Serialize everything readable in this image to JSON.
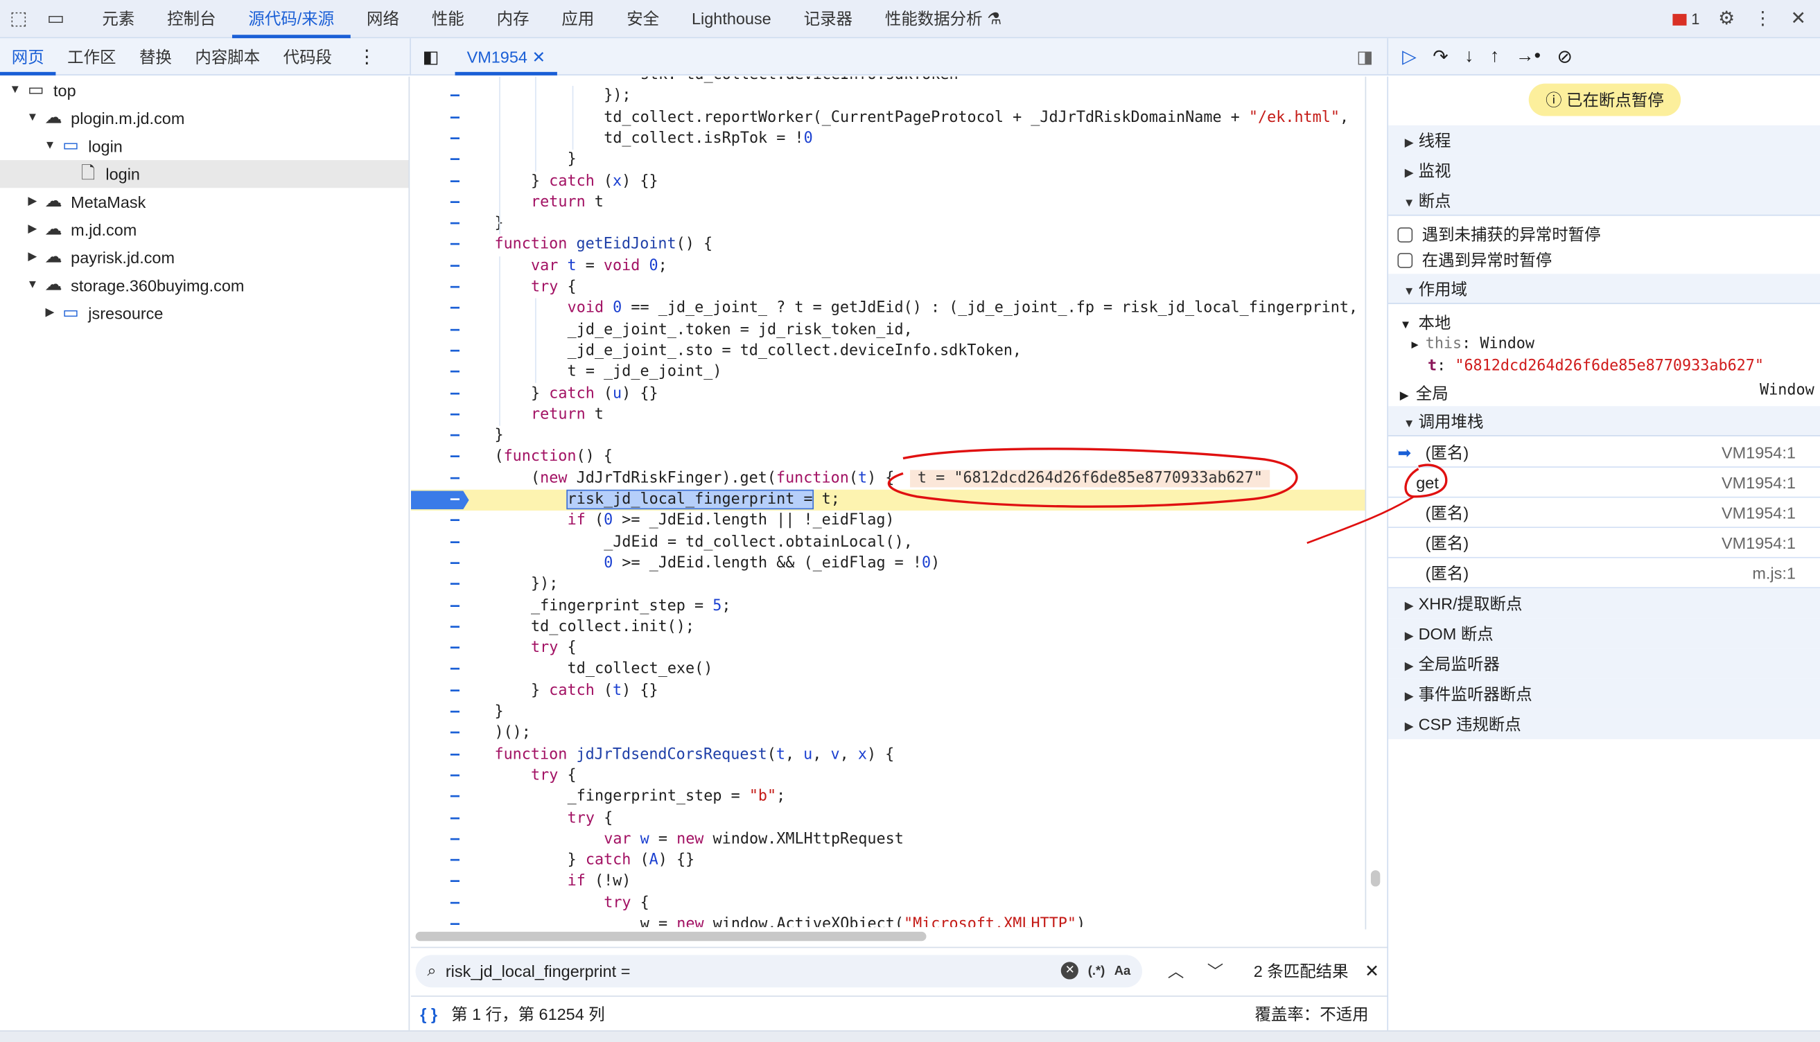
{
  "toolbar": {
    "tabs": [
      "元素",
      "控制台",
      "源代码/来源",
      "网络",
      "性能",
      "内存",
      "应用",
      "安全",
      "Lighthouse",
      "记录器",
      "性能数据分析 ⚗"
    ],
    "active": 2,
    "error_count": "1"
  },
  "navigator": {
    "tabs": [
      "网页",
      "工作区",
      "替换",
      "内容脚本",
      "代码段"
    ],
    "active": 0,
    "tree": [
      {
        "label": "top",
        "depth": 0,
        "open": true,
        "icon": "window-icon"
      },
      {
        "label": "plogin.m.jd.com",
        "depth": 1,
        "open": true,
        "icon": "cloud-icon"
      },
      {
        "label": "login",
        "depth": 2,
        "open": true,
        "icon": "folder-icon"
      },
      {
        "label": "login",
        "depth": 3,
        "open": null,
        "icon": "file-icon",
        "selected": true
      },
      {
        "label": "MetaMask",
        "depth": 1,
        "open": false,
        "icon": "cloud-icon"
      },
      {
        "label": "m.jd.com",
        "depth": 1,
        "open": false,
        "icon": "cloud-icon"
      },
      {
        "label": "payrisk.jd.com",
        "depth": 1,
        "open": false,
        "icon": "cloud-icon"
      },
      {
        "label": "storage.360buyimg.com",
        "depth": 1,
        "open": true,
        "icon": "cloud-icon"
      },
      {
        "label": "jsresource",
        "depth": 2,
        "open": false,
        "icon": "folder-icon"
      }
    ]
  },
  "editor": {
    "file_tab": "VM1954",
    "current_line": 20,
    "lines": [
      {
        "i": 4,
        "t": [
          [
            "p",
            "stk: td_collect.deviceInfo.sdkToken"
          ]
        ]
      },
      {
        "i": 3,
        "t": [
          [
            "p",
            "});"
          ]
        ]
      },
      {
        "i": 3,
        "t": [
          [
            "p",
            "td_collect.reportWorker(_CurrentPageProtocol + _JdJrTdRiskDomainName + "
          ],
          [
            "s",
            "\"/ek.html\""
          ],
          [
            "p",
            ","
          ]
        ]
      },
      {
        "i": 3,
        "t": [
          [
            "p",
            "td_collect.isRpTok = !"
          ],
          [
            "n",
            "0"
          ]
        ]
      },
      {
        "i": 2,
        "t": [
          [
            "p",
            "}"
          ]
        ]
      },
      {
        "i": 1,
        "t": [
          [
            "p",
            "} "
          ],
          [
            "k",
            "catch"
          ],
          [
            "p",
            " ("
          ],
          [
            "n",
            "x"
          ],
          [
            "p",
            ") {}"
          ]
        ]
      },
      {
        "i": 1,
        "t": [
          [
            "k",
            "return"
          ],
          [
            "p",
            " t"
          ]
        ]
      },
      {
        "i": 0,
        "t": [
          [
            "p",
            "}"
          ]
        ]
      },
      {
        "i": 0,
        "t": [
          [
            "k",
            "function"
          ],
          [
            "f",
            " getEidJoint"
          ],
          [
            "p",
            "() {"
          ]
        ]
      },
      {
        "i": 1,
        "t": [
          [
            "k",
            "var"
          ],
          [
            "n",
            " t"
          ],
          [
            "p",
            " = "
          ],
          [
            "k",
            "void"
          ],
          [
            "n",
            " 0"
          ],
          [
            "p",
            ";"
          ]
        ]
      },
      {
        "i": 1,
        "t": [
          [
            "k",
            "try"
          ],
          [
            "p",
            " {"
          ]
        ]
      },
      {
        "i": 2,
        "t": [
          [
            "k",
            "void"
          ],
          [
            "n",
            " 0"
          ],
          [
            "p",
            " == _jd_e_joint_ ? t = getJdEid() : (_jd_e_joint_.fp = risk_jd_local_fingerprint,"
          ]
        ]
      },
      {
        "i": 2,
        "t": [
          [
            "p",
            "_jd_e_joint_.token = jd_risk_token_id,"
          ]
        ]
      },
      {
        "i": 2,
        "t": [
          [
            "p",
            "_jd_e_joint_.sto = td_collect.deviceInfo.sdkToken,"
          ]
        ]
      },
      {
        "i": 2,
        "t": [
          [
            "p",
            "t = _jd_e_joint_)"
          ]
        ]
      },
      {
        "i": 1,
        "t": [
          [
            "p",
            "} "
          ],
          [
            "k",
            "catch"
          ],
          [
            "p",
            " ("
          ],
          [
            "n",
            "u"
          ],
          [
            "p",
            ") {}"
          ]
        ]
      },
      {
        "i": 1,
        "t": [
          [
            "k",
            "return"
          ],
          [
            "p",
            " t"
          ]
        ]
      },
      {
        "i": 0,
        "t": [
          [
            "p",
            "}"
          ]
        ]
      },
      {
        "i": 0,
        "t": [
          [
            "p",
            "("
          ],
          [
            "k",
            "function"
          ],
          [
            "p",
            "() {"
          ]
        ]
      },
      {
        "i": 1,
        "t": [
          [
            "p",
            "("
          ],
          [
            "k",
            "new"
          ],
          [
            "p",
            " JdJrTdRiskFinger).get("
          ],
          [
            "k",
            "function"
          ],
          [
            "p",
            "("
          ],
          [
            "n",
            "t"
          ],
          [
            "p",
            ") {"
          ]
        ],
        "inline": "t = \"6812dcd264d26f6de85e8770933ab627\""
      },
      {
        "i": 2,
        "t": [
          [
            "h",
            "risk_jd_local_fingerprint ="
          ],
          [
            "p",
            " t;"
          ]
        ]
      },
      {
        "i": 2,
        "t": [
          [
            "k",
            "if"
          ],
          [
            "p",
            " ("
          ],
          [
            "n",
            "0"
          ],
          [
            "p",
            " >= _JdEid.length || !_eidFlag)"
          ]
        ]
      },
      {
        "i": 3,
        "t": [
          [
            "p",
            "_JdEid = td_collect.obtainLocal(),"
          ]
        ]
      },
      {
        "i": 3,
        "t": [
          [
            "n",
            "0"
          ],
          [
            "p",
            " >= _JdEid.length && (_eidFlag = !"
          ],
          [
            "n",
            "0"
          ],
          [
            "p",
            ")"
          ]
        ]
      },
      {
        "i": 1,
        "t": [
          [
            "p",
            "});"
          ]
        ]
      },
      {
        "i": 1,
        "t": [
          [
            "p",
            "_fingerprint_step = "
          ],
          [
            "n",
            "5"
          ],
          [
            "p",
            ";"
          ]
        ]
      },
      {
        "i": 1,
        "t": [
          [
            "p",
            "td_collect.init();"
          ]
        ]
      },
      {
        "i": 1,
        "t": [
          [
            "k",
            "try"
          ],
          [
            "p",
            " {"
          ]
        ]
      },
      {
        "i": 2,
        "t": [
          [
            "p",
            "td_collect_exe()"
          ]
        ]
      },
      {
        "i": 1,
        "t": [
          [
            "p",
            "} "
          ],
          [
            "k",
            "catch"
          ],
          [
            "p",
            " ("
          ],
          [
            "n",
            "t"
          ],
          [
            "p",
            ") {}"
          ]
        ]
      },
      {
        "i": 0,
        "t": [
          [
            "p",
            "}"
          ]
        ]
      },
      {
        "i": 0,
        "t": [
          [
            "p",
            ")();"
          ]
        ]
      },
      {
        "i": 0,
        "t": [
          [
            "k",
            "function"
          ],
          [
            "f",
            " jdJrTdsendCorsRequest"
          ],
          [
            "p",
            "("
          ],
          [
            "n",
            "t"
          ],
          [
            "p",
            ", "
          ],
          [
            "n",
            "u"
          ],
          [
            "p",
            ", "
          ],
          [
            "n",
            "v"
          ],
          [
            "p",
            ", "
          ],
          [
            "n",
            "x"
          ],
          [
            "p",
            ") {"
          ]
        ]
      },
      {
        "i": 1,
        "t": [
          [
            "k",
            "try"
          ],
          [
            "p",
            " {"
          ]
        ]
      },
      {
        "i": 2,
        "t": [
          [
            "p",
            "_fingerprint_step = "
          ],
          [
            "s",
            "\"b\""
          ],
          [
            "p",
            ";"
          ]
        ]
      },
      {
        "i": 2,
        "t": [
          [
            "k",
            "try"
          ],
          [
            "p",
            " {"
          ]
        ]
      },
      {
        "i": 3,
        "t": [
          [
            "k",
            "var"
          ],
          [
            "n",
            " w"
          ],
          [
            "p",
            " = "
          ],
          [
            "k",
            "new"
          ],
          [
            "p",
            " window.XMLHttpRequest"
          ]
        ]
      },
      {
        "i": 2,
        "t": [
          [
            "p",
            "} "
          ],
          [
            "k",
            "catch"
          ],
          [
            "p",
            " ("
          ],
          [
            "n",
            "A"
          ],
          [
            "p",
            ") {}"
          ]
        ]
      },
      {
        "i": 2,
        "t": [
          [
            "k",
            "if"
          ],
          [
            "p",
            " (!w)"
          ]
        ]
      },
      {
        "i": 3,
        "t": [
          [
            "k",
            "try"
          ],
          [
            "p",
            " {"
          ]
        ]
      },
      {
        "i": 4,
        "t": [
          [
            "p",
            "w = "
          ],
          [
            "k",
            "new"
          ],
          [
            "p",
            " window.ActiveXObject("
          ],
          [
            "s",
            "\"Microsoft.XMLHTTP\""
          ],
          [
            "p",
            ")"
          ]
        ]
      }
    ]
  },
  "search": {
    "value": "risk_jd_local_fingerprint =",
    "regex_label": "(.*)",
    "case_label": "Aa",
    "result": "2 条匹配结果"
  },
  "status": {
    "position": "第 1 行，第 61254 列",
    "coverage": "覆盖率：不适用"
  },
  "debugger": {
    "paused": "已在断点暂停",
    "sections": {
      "threads": "线程",
      "watch": "监视",
      "breakpoints": "断点",
      "scope": "作用域",
      "callstack": "调用堆栈",
      "xhr": "XHR/提取断点",
      "dom": "DOM 断点",
      "global": "全局监听器",
      "event": "事件监听器断点",
      "csp": "CSP 违规断点"
    },
    "bp_options": [
      "遇到未捕获的异常时暂停",
      "在遇到异常时暂停"
    ],
    "scope": {
      "local": "本地",
      "this_key": "this",
      "this_val": "Window",
      "t_key": "t",
      "t_val": "\"6812dcd264d26f6de85e8770933ab627\"",
      "global": "全局",
      "global_val": "Window"
    },
    "stack": [
      {
        "name": "(匿名)",
        "loc": "VM1954:1",
        "current": true
      },
      {
        "name": "get",
        "loc": "VM1954:1"
      },
      {
        "name": "(匿名)",
        "loc": "VM1954:1"
      },
      {
        "name": "(匿名)",
        "loc": "VM1954:1"
      },
      {
        "name": "(匿名)",
        "loc": "m.js:1"
      }
    ]
  },
  "colors": {
    "accent": "#1a5fd6",
    "paused_bg": "#fcef9c",
    "current_line": "#fdf3b0",
    "annotation": "#e01010"
  }
}
